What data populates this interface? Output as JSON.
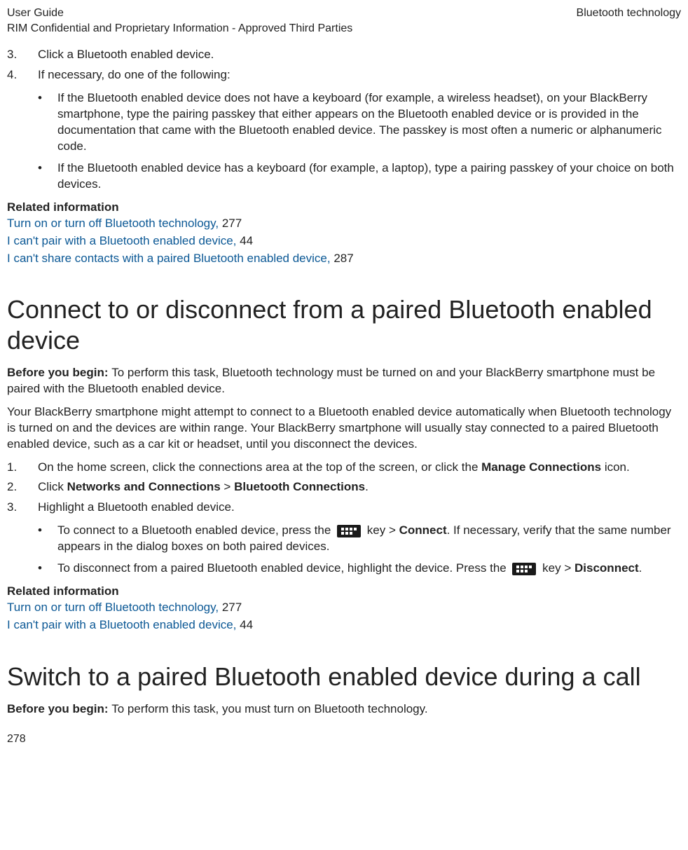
{
  "header": {
    "left_line1": "User Guide",
    "left_line2": "RIM Confidential and Proprietary Information - Approved Third Parties",
    "right": "Bluetooth technology"
  },
  "steps_top": [
    {
      "num": "3.",
      "text": "Click a Bluetooth enabled device."
    },
    {
      "num": "4.",
      "text": "If necessary, do one of the following:"
    }
  ],
  "bullets_top": [
    "If the Bluetooth enabled device does not have a keyboard (for example, a wireless headset), on your BlackBerry smartphone, type the pairing passkey that either appears on the Bluetooth enabled device or is provided in the documentation that came with the Bluetooth enabled device. The passkey is most often a numeric or alphanumeric code.",
    "If the Bluetooth enabled device has a keyboard (for example, a laptop), type a pairing passkey of your choice on both devices."
  ],
  "related1": {
    "heading": "Related information",
    "links": [
      {
        "text": "Turn on or turn off Bluetooth technology,",
        "page": " 277"
      },
      {
        "text": "I can't pair with a Bluetooth enabled device,",
        "page": " 44"
      },
      {
        "text": "I can't share contacts with a paired Bluetooth enabled device,",
        "page": " 287"
      }
    ]
  },
  "section2": {
    "title": "Connect to or disconnect from a paired Bluetooth enabled device",
    "before_label": "Before you begin: ",
    "before_text": "To perform this task, Bluetooth technology must be turned on and your BlackBerry smartphone must be paired with the Bluetooth enabled device.",
    "para": "Your BlackBerry smartphone might attempt to connect to a Bluetooth enabled device automatically when Bluetooth technology is turned on and the devices are within range. Your BlackBerry smartphone will usually stay connected to a paired Bluetooth enabled device, such as a car kit or headset, until you disconnect the devices.",
    "steps": [
      {
        "num": "1.",
        "pre": "On the home screen, click the connections area at the top of the screen, or click the ",
        "bold1": "Manage Connections",
        "post": " icon."
      },
      {
        "num": "2.",
        "pre": "Click ",
        "bold1": "Networks and Connections",
        "mid": " > ",
        "bold2": "Bluetooth Connections",
        "post": "."
      },
      {
        "num": "3.",
        "pre": "Highlight a Bluetooth enabled device."
      }
    ],
    "sub_bullets": [
      {
        "pre": "To connect to a Bluetooth enabled device, press the ",
        "key_after": " key > ",
        "bold": "Connect",
        "post": ". If necessary, verify that the same number appears in the dialog boxes on both paired devices."
      },
      {
        "pre": "To disconnect from a paired Bluetooth enabled device, highlight the device. Press the ",
        "key_after": " key > ",
        "bold": "Disconnect",
        "post": "."
      }
    ]
  },
  "related2": {
    "heading": "Related information",
    "links": [
      {
        "text": "Turn on or turn off Bluetooth technology,",
        "page": " 277"
      },
      {
        "text": "I can't pair with a Bluetooth enabled device,",
        "page": " 44"
      }
    ]
  },
  "section3": {
    "title": "Switch to a paired Bluetooth enabled device during a call",
    "before_label": "Before you begin: ",
    "before_text": "To perform this task, you must turn on Bluetooth technology."
  },
  "page_number": "278"
}
